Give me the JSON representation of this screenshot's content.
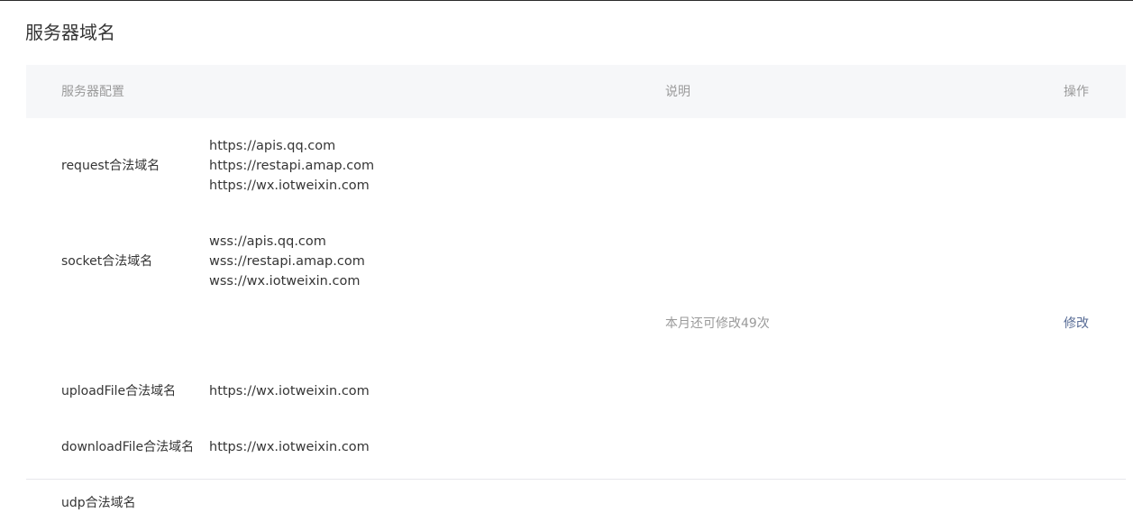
{
  "page": {
    "title": "服务器域名"
  },
  "table": {
    "headers": {
      "config": "服务器配置",
      "description": "说明",
      "operation": "操作"
    },
    "rows": [
      {
        "label": "request合法域名",
        "values": [
          "https://apis.qq.com",
          "https://restapi.amap.com",
          "https://wx.iotweixin.com"
        ]
      },
      {
        "label": "socket合法域名",
        "values": [
          "wss://apis.qq.com",
          "wss://restapi.amap.com",
          "wss://wx.iotweixin.com"
        ]
      },
      {
        "label": "uploadFile合法域名",
        "values": [
          "https://wx.iotweixin.com"
        ]
      },
      {
        "label": "downloadFile合法域名",
        "values": [
          "https://wx.iotweixin.com"
        ]
      },
      {
        "label": "udp合法域名",
        "values": []
      }
    ],
    "description_text": "本月还可修改49次",
    "modify_label": "修改"
  },
  "colors": {
    "text": "#353535",
    "muted": "#9a9a9a",
    "link": "#576b95",
    "header_bg": "#f6f7f9"
  }
}
